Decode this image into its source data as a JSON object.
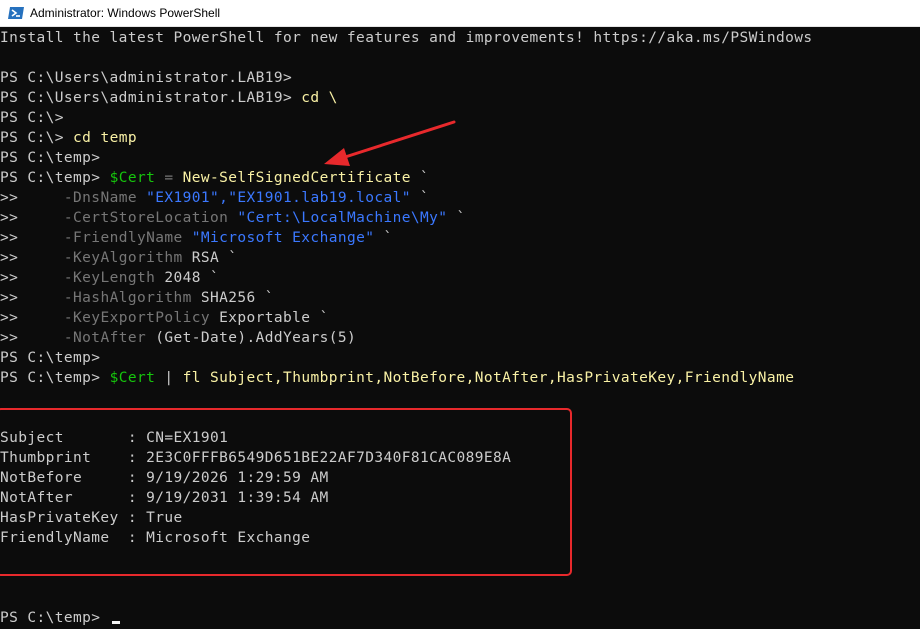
{
  "window": {
    "title": "Administrator: Windows PowerShell"
  },
  "colors": {
    "background": "#0c0c0c",
    "text": "#cccccc",
    "command": "#f9f1a5",
    "variable": "#16c60c",
    "string": "#3b78ff",
    "parameter": "#767676",
    "annotation": "#e8292c"
  },
  "console": {
    "banner": "Install the latest PowerShell for new features and improvements! https://aka.ms/PSWindows",
    "lines": [
      {
        "prompt": "PS C:\\Users\\administrator.LAB19>",
        "text": ""
      },
      {
        "prompt": "PS C:\\Users\\administrator.LAB19>",
        "text": " cd \\"
      },
      {
        "prompt": "PS C:\\>",
        "text": ""
      },
      {
        "prompt": "PS C:\\>",
        "text": " cd temp"
      },
      {
        "prompt": "PS C:\\temp>",
        "text": ""
      }
    ],
    "cert_cmd": {
      "prompt": "PS C:\\temp>",
      "variable": "$Cert",
      "assign": " = ",
      "cmdlet": "New-SelfSignedCertificate",
      "tick": " `"
    },
    "continuation_prompt": ">>",
    "params": [
      {
        "name": "-DnsName",
        "value": "\"EX1901\",\"EX1901.lab19.local\"",
        "tick": " `",
        "type": "string"
      },
      {
        "name": "-CertStoreLocation",
        "value": "\"Cert:\\LocalMachine\\My\"",
        "tick": " `",
        "type": "string"
      },
      {
        "name": "-FriendlyName",
        "value": "\"Microsoft Exchange\"",
        "tick": " `",
        "type": "string"
      },
      {
        "name": "-KeyAlgorithm",
        "value": "RSA",
        "tick": " `",
        "type": "plain"
      },
      {
        "name": "-KeyLength",
        "value": "2048",
        "tick": " `",
        "type": "plain"
      },
      {
        "name": "-HashAlgorithm",
        "value": "SHA256",
        "tick": " `",
        "type": "plain"
      },
      {
        "name": "-KeyExportPolicy",
        "value": "Exportable",
        "tick": " `",
        "type": "plain"
      },
      {
        "name": "-NotAfter",
        "value": "(Get-Date).AddYears(5)",
        "tick": "",
        "type": "plain"
      }
    ],
    "after_params_prompt": "PS C:\\temp>",
    "fl_cmd": {
      "prompt": "PS C:\\temp>",
      "variable": "$Cert",
      "pipe": " | ",
      "cmdlet": "fl",
      "args": " Subject,Thumbprint,NotBefore,NotAfter,HasPrivateKey,FriendlyName"
    },
    "output": [
      {
        "key": "Subject       ",
        "value": "CN=EX1901"
      },
      {
        "key": "Thumbprint    ",
        "value": "2E3C0FFFB6549D651BE22AF7D340F81CAC089E8A"
      },
      {
        "key": "NotBefore     ",
        "value": "9/19/2026 1:29:59 AM"
      },
      {
        "key": "NotAfter      ",
        "value": "9/19/2031 1:39:54 AM"
      },
      {
        "key": "HasPrivateKey ",
        "value": "True"
      },
      {
        "key": "FriendlyName  ",
        "value": "Microsoft Exchange"
      }
    ],
    "separator": ": ",
    "final_prompt": "PS C:\\temp>"
  }
}
